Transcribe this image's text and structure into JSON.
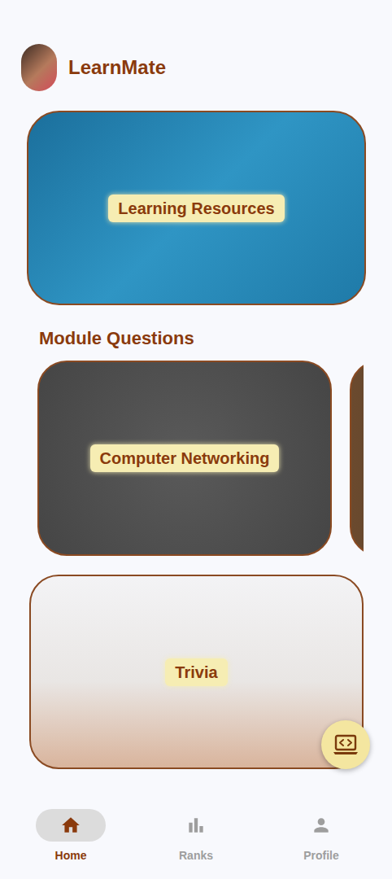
{
  "header": {
    "app_name": "LearnMate"
  },
  "resources_card": {
    "label": "Learning Resources"
  },
  "section": {
    "title": "Module Questions"
  },
  "module_cards": [
    {
      "label": "Computer Networking"
    },
    {
      "label": ""
    }
  ],
  "trivia_card": {
    "label": "Trivia"
  },
  "bottom_nav": [
    {
      "label": "Home",
      "selected": true
    },
    {
      "label": "Ranks",
      "selected": false
    },
    {
      "label": "Profile",
      "selected": false
    }
  ]
}
